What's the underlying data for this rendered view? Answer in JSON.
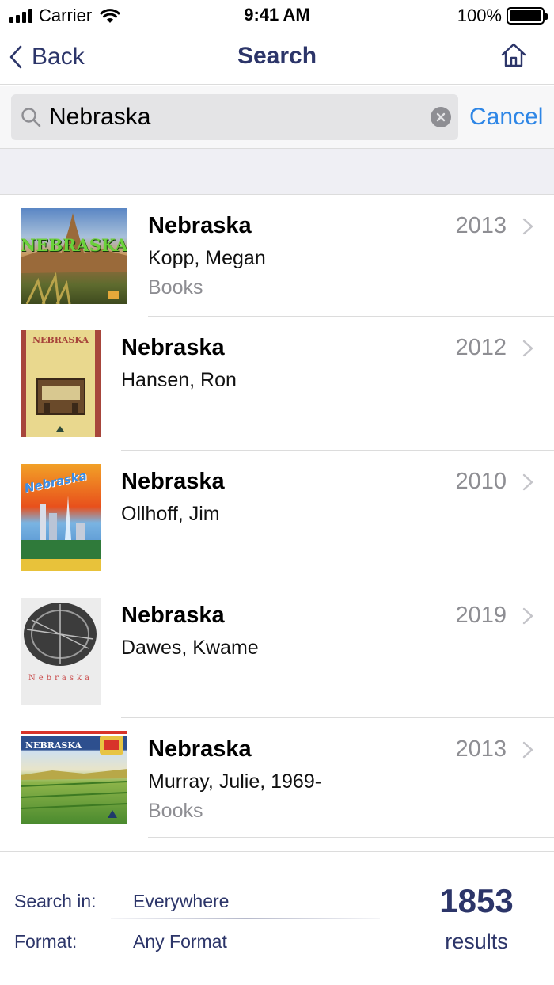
{
  "status_bar": {
    "carrier": "Carrier",
    "time": "9:41 AM",
    "battery_percent": "100%",
    "battery_level": 1.0,
    "icons": [
      "signal-bars-icon",
      "wifi-icon",
      "battery-icon"
    ]
  },
  "nav": {
    "back_label": "Back",
    "title": "Search",
    "home_icon": "home-icon"
  },
  "search": {
    "value": "Nebraska",
    "cancel_label": "Cancel",
    "icons": [
      "magnifier-icon",
      "clear-icon"
    ]
  },
  "results": [
    {
      "title": "Nebraska",
      "author": "Kopp, Megan",
      "format": "Books",
      "year": "2013",
      "cover_text": "NEBRASKA"
    },
    {
      "title": "Nebraska",
      "author": "Hansen, Ron",
      "format": "",
      "year": "2012",
      "cover_text": "NEBRASKA"
    },
    {
      "title": "Nebraska",
      "author": "Ollhoff, Jim",
      "format": "",
      "year": "2010",
      "cover_text": "Nebraska"
    },
    {
      "title": "Nebraska",
      "author": "Dawes, Kwame",
      "format": "",
      "year": "2019",
      "cover_text": "Nebraska"
    },
    {
      "title": "Nebraska",
      "author": "Murray, Julie, 1969-",
      "format": "Books",
      "year": "2013",
      "cover_text": "NEBRASKA"
    }
  ],
  "footer": {
    "search_in_label": "Search in:",
    "search_in_value": "Everywhere",
    "format_label": "Format:",
    "format_value": "Any Format",
    "count": "1853",
    "count_label": "results"
  },
  "colors": {
    "navy": "#2c3569",
    "link_blue": "#2e86e6",
    "gray_text": "#8e8e93",
    "search_field": "#e4e4e6",
    "band": "#efeff4"
  }
}
